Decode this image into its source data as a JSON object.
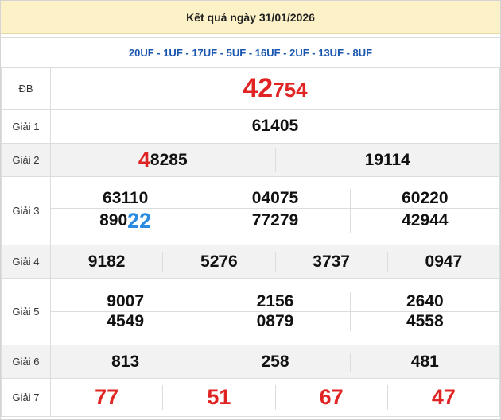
{
  "header": {
    "title": "Kết quả ngày 31/01/2026"
  },
  "codes": "20UF - 1UF - 17UF - 5UF - 16UF - 2UF - 13UF - 8UF",
  "prizes": {
    "db": {
      "label": "ĐB",
      "big": "42",
      "rest": "754"
    },
    "g1": {
      "label": "Giải 1",
      "value": "61405"
    },
    "g2": {
      "label": "Giải 2",
      "a_big": "4",
      "a_rest": "8285",
      "b": "19114"
    },
    "g3": {
      "label": "Giải 3",
      "row1": [
        "63110",
        "04075",
        "60220"
      ],
      "r2a_start": "890",
      "r2a_big": "22",
      "row2_b": "77279",
      "row2_c": "42944"
    },
    "g4": {
      "label": "Giải 4",
      "values": [
        "9182",
        "5276",
        "3737",
        "0947"
      ]
    },
    "g5": {
      "label": "Giải 5",
      "row1": [
        "9007",
        "2156",
        "2640"
      ],
      "row2": [
        "4549",
        "0879",
        "4558"
      ]
    },
    "g6": {
      "label": "Giải 6",
      "values": [
        "813",
        "258",
        "481"
      ]
    },
    "g7": {
      "label": "Giải 7",
      "values": [
        "77",
        "51",
        "67",
        "47"
      ]
    }
  },
  "colors": {
    "header_bg": "#fdf1c8",
    "red": "#e02424",
    "blue": "#2a8be0",
    "code_blue": "#1a56b0"
  }
}
